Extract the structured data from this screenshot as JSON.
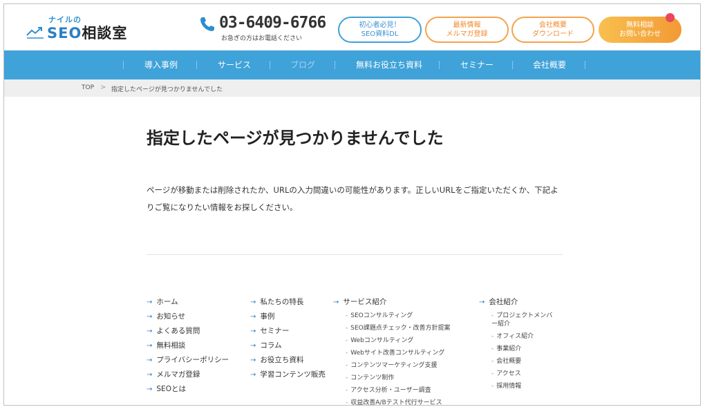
{
  "header": {
    "logo": {
      "sub": "ナイルの",
      "main_latin": "SEO",
      "main_kanji": "相談室"
    },
    "phone": {
      "number": "03-6409-6766",
      "note": "お急ぎの方はお電話ください"
    },
    "buttons": [
      {
        "line1": "初心者必見！",
        "line2": "SEO資料DL"
      },
      {
        "line1": "最新情報",
        "line2": "メルマガ登録"
      },
      {
        "line1": "会社概要",
        "line2": "ダウンロード"
      },
      {
        "line1": "無料相談",
        "line2": "お問い合わせ"
      }
    ]
  },
  "nav": {
    "items": [
      "導入事例",
      "サービス",
      "ブログ",
      "無料お役立ち資料",
      "セミナー",
      "会社概要"
    ]
  },
  "breadcrumb": {
    "top": "TOP",
    "separator": ">",
    "current": "指定したページが見つかりませんでした"
  },
  "main": {
    "title": "指定したページが見つかりませんでした",
    "message": "ページが移動または削除されたか、URLの入力間違いの可能性があります。正しいURLをご指定いただくか、下記よりご覧になりたい情報をお探しください。"
  },
  "sitemap": {
    "arrow": "→",
    "dash": "-",
    "col1": [
      "ホーム",
      "お知らせ",
      "よくある質問",
      "無料相談",
      "プライバシーポリシー",
      "メルマガ登録",
      "SEOとは"
    ],
    "col2": [
      "私たちの特長",
      "事例",
      "セミナー",
      "コラム",
      "お役立ち資料",
      "学習コンテンツ販売"
    ],
    "col3": {
      "head": "サービス紹介",
      "items": [
        "SEOコンサルティング",
        "SEO課題点チェック・改善方針提案",
        "Webコンサルティング",
        "Webサイト改善コンサルティング",
        "コンテンツマーケティング支援",
        "コンテンツ制作",
        "アクセス分析・ユーザー調査",
        "収益改善A/Bテスト代行サービス"
      ]
    },
    "col4": {
      "head": "会社紹介",
      "items": [
        "プロジェクトメンバー紹介",
        "オフィス紹介",
        "事業紹介",
        "会社概要",
        "アクセス",
        "採用情報"
      ]
    }
  },
  "colors": {
    "brand_blue": "#3fa2d9",
    "accent_orange": "#f29a36",
    "notify_red": "#e8485a"
  }
}
